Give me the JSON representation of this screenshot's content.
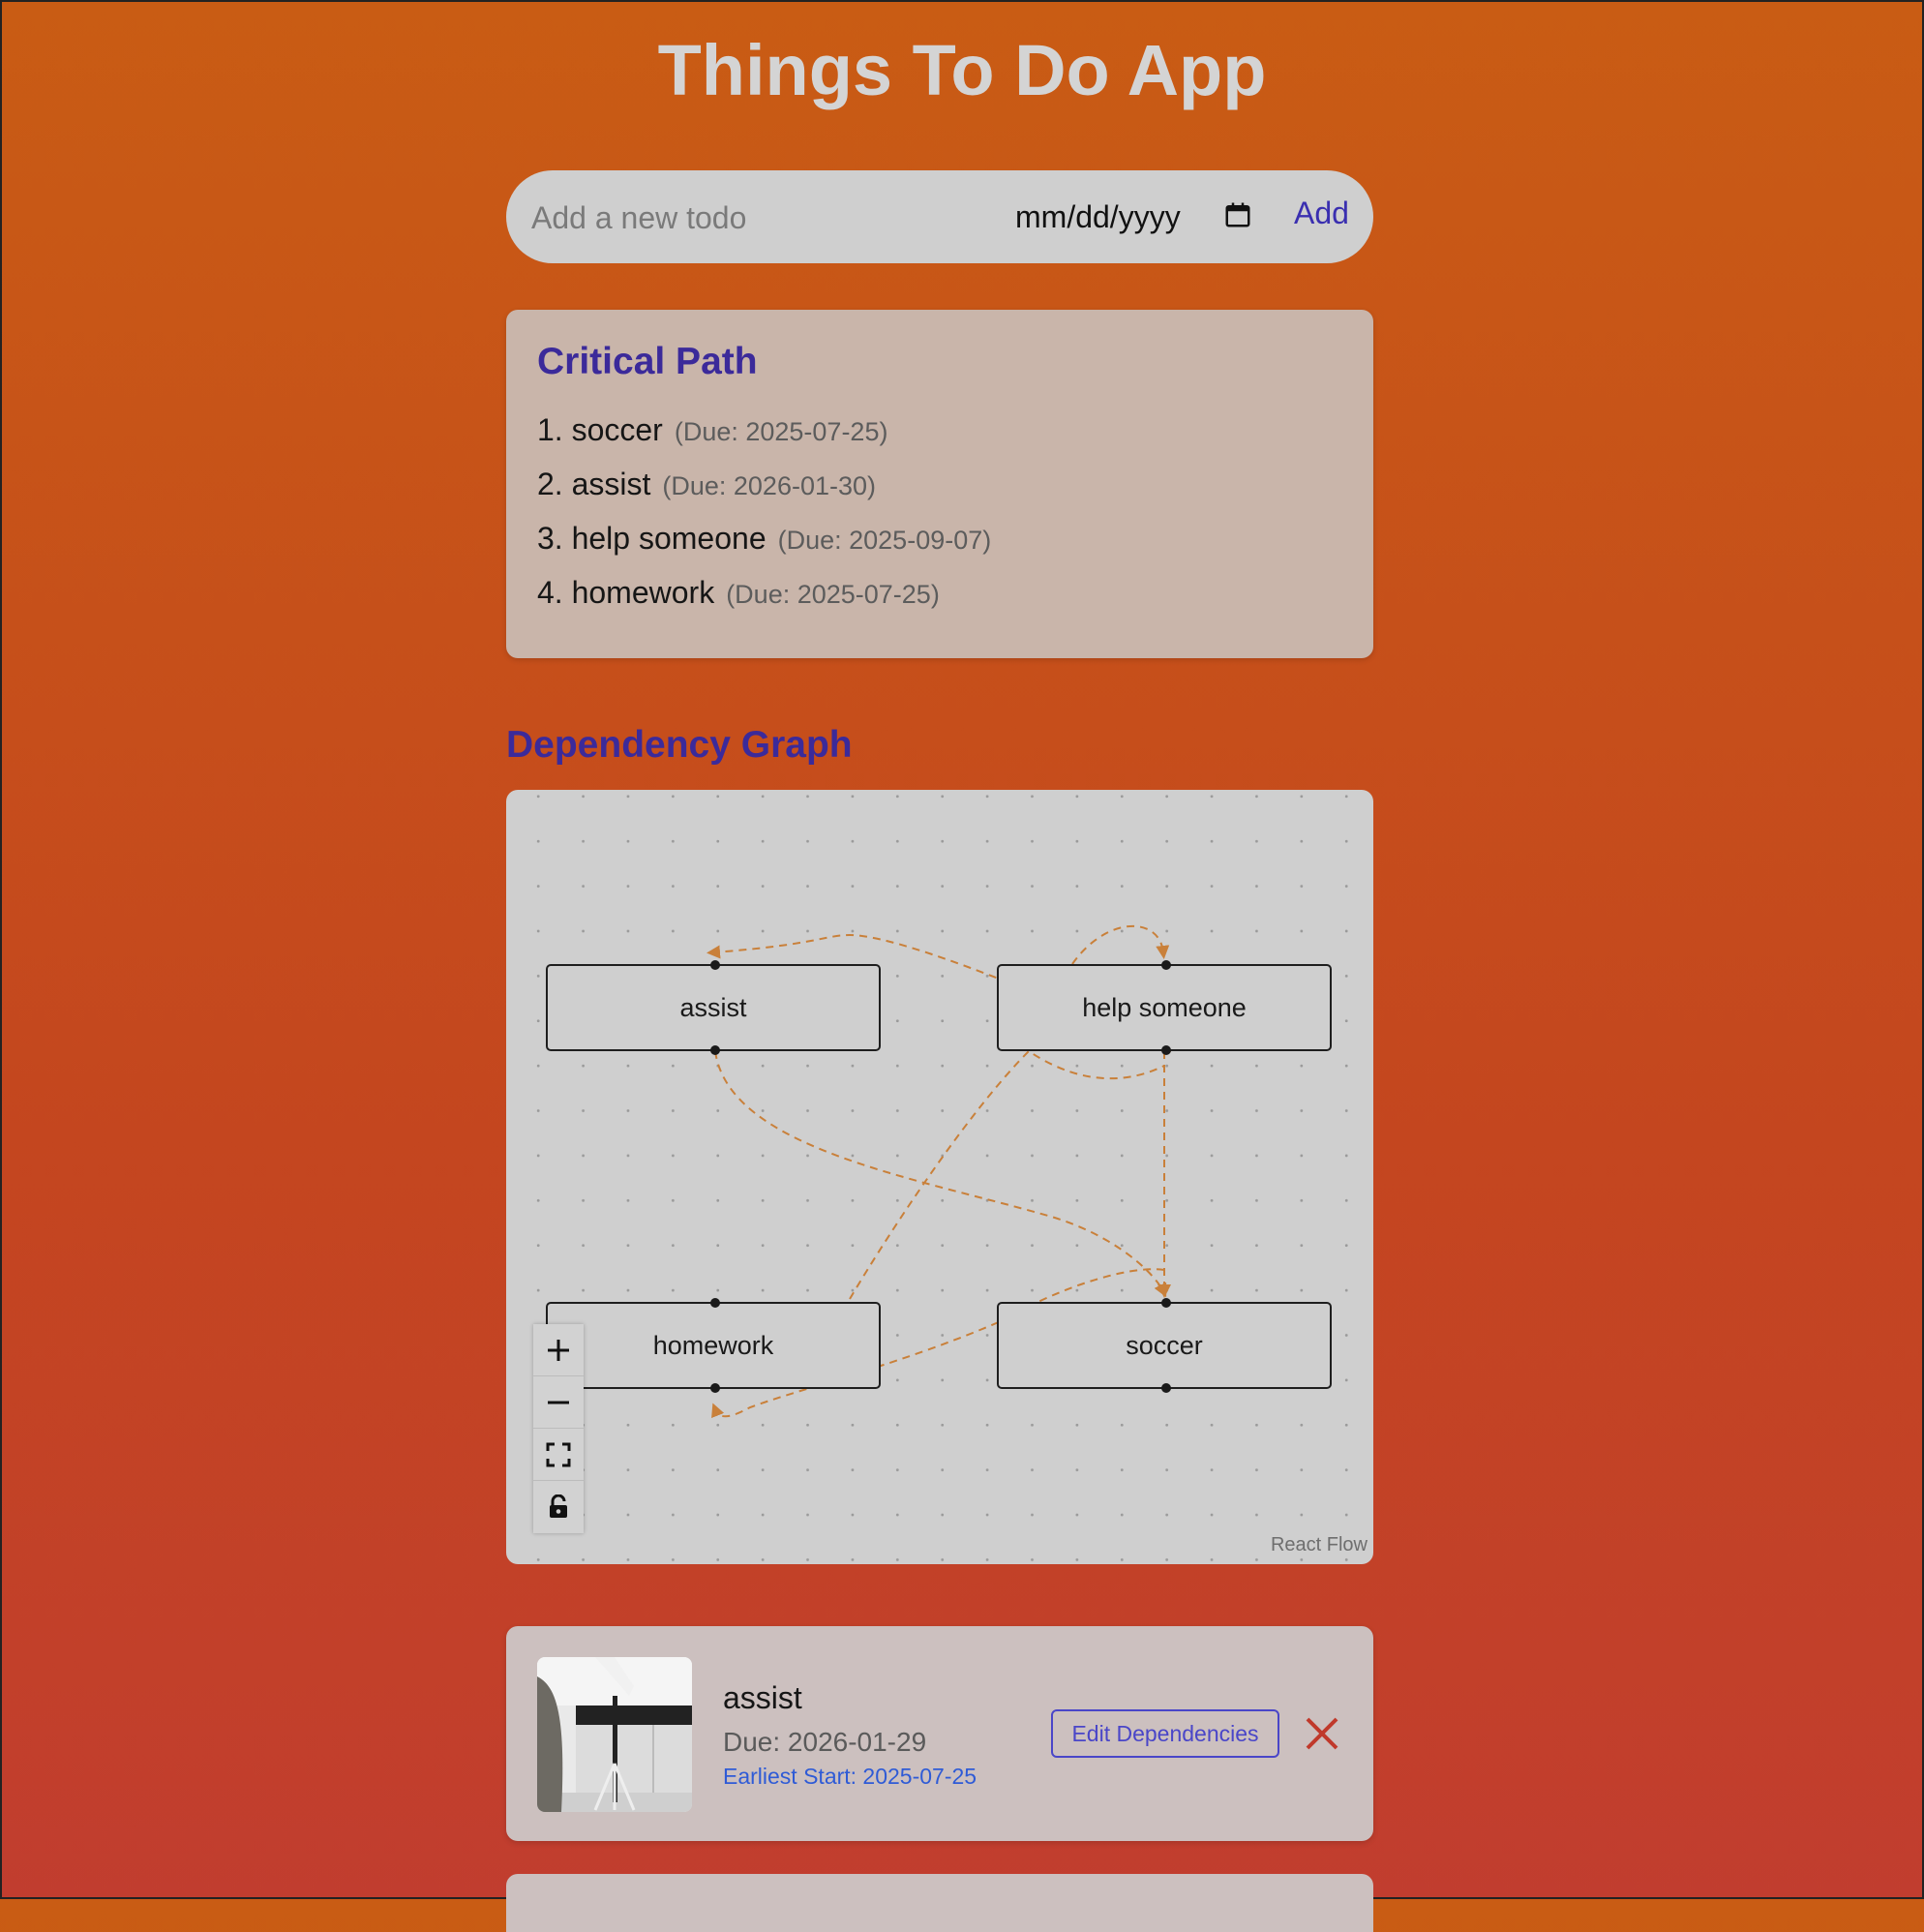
{
  "app": {
    "title": "Things To Do App"
  },
  "add_bar": {
    "placeholder": "Add a new todo",
    "date_placeholder": "mm/dd/yyyy",
    "add_label": "Add",
    "icon": "calendar-icon"
  },
  "critical_path": {
    "title": "Critical Path",
    "items": [
      {
        "label": "1. soccer",
        "due": "(Due: 2025-07-25)"
      },
      {
        "label": "2. assist",
        "due": "(Due: 2026-01-30)"
      },
      {
        "label": "3. help someone",
        "due": "(Due: 2025-09-07)"
      },
      {
        "label": "4. homework",
        "due": "(Due: 2025-07-25)"
      }
    ]
  },
  "dependency_graph": {
    "title": "Dependency Graph",
    "nodes": [
      {
        "id": "assist",
        "label": "assist"
      },
      {
        "id": "help-someone",
        "label": "help someone"
      },
      {
        "id": "homework",
        "label": "homework"
      },
      {
        "id": "soccer",
        "label": "soccer"
      }
    ],
    "edges": [
      {
        "from": "help someone",
        "to": "assist"
      },
      {
        "from": "help someone",
        "to": "help someone"
      },
      {
        "from": "assist",
        "to": "soccer"
      },
      {
        "from": "help someone",
        "to": "soccer"
      },
      {
        "from": "homework",
        "to": "help someone"
      },
      {
        "from": "soccer",
        "to": "homework"
      }
    ],
    "edge_color": "#c9803a",
    "controls": [
      "plus-icon",
      "minus-icon",
      "fit-view-icon",
      "lock-icon"
    ],
    "attribution": "React Flow"
  },
  "todos": [
    {
      "name": "assist",
      "due": "Due: 2026-01-29",
      "earliest_start": "Earliest Start: 2025-07-25",
      "edit_label": "Edit Dependencies",
      "delete_icon": "close-icon"
    }
  ],
  "colors": {
    "background_top": "#c95c14",
    "background_bottom": "#c13d2f",
    "accent": "#3b2a9a",
    "link": "#2f5bd6",
    "delete": "#c0392b"
  }
}
